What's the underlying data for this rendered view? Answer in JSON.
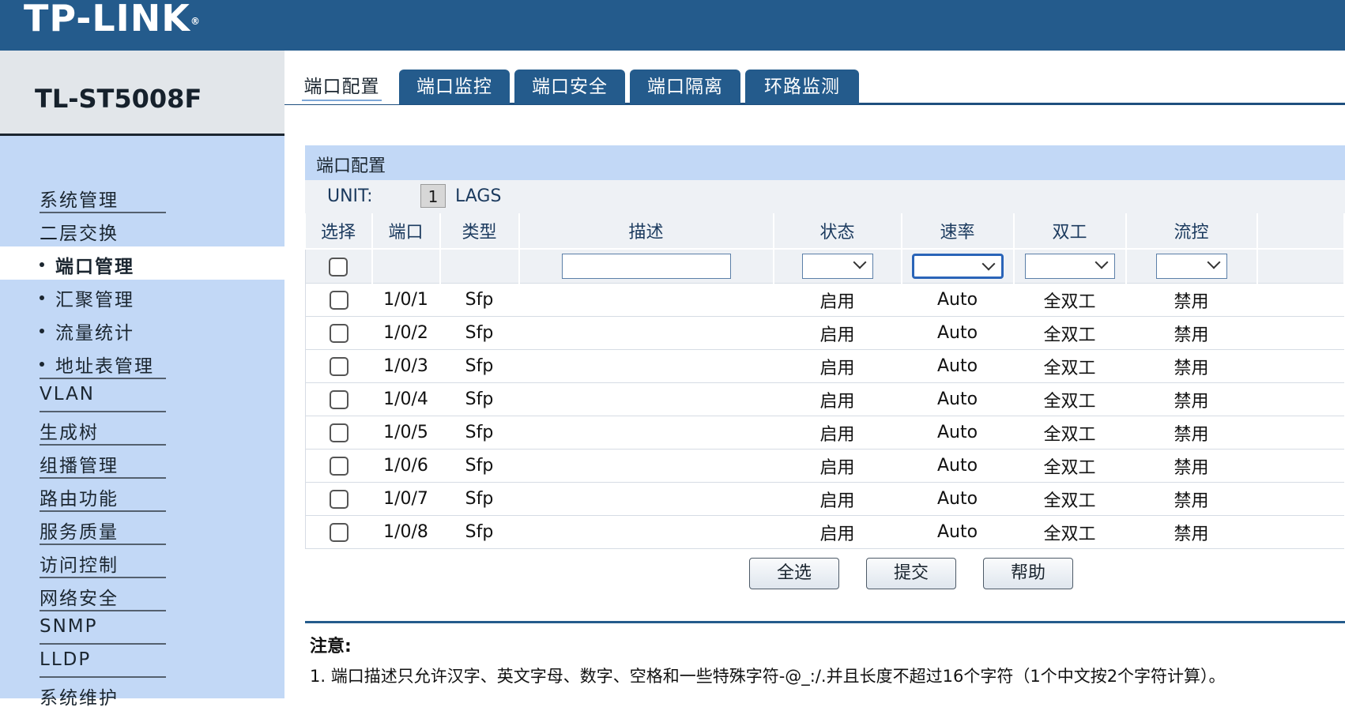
{
  "header": {
    "logo_text": "TP-LINK",
    "logo_mark": "®"
  },
  "device": {
    "model": "TL-ST5008F"
  },
  "sidebar": {
    "items": [
      {
        "label": "系统管理"
      },
      {
        "label": "二层交换"
      },
      {
        "label": "端口管理"
      },
      {
        "label": "汇聚管理"
      },
      {
        "label": "流量统计"
      },
      {
        "label": "地址表管理"
      },
      {
        "label": "VLAN"
      },
      {
        "label": "生成树"
      },
      {
        "label": "组播管理"
      },
      {
        "label": "路由功能"
      },
      {
        "label": "服务质量"
      },
      {
        "label": "访问控制"
      },
      {
        "label": "网络安全"
      },
      {
        "label": "SNMP"
      },
      {
        "label": "LLDP"
      },
      {
        "label": "系统维护"
      }
    ]
  },
  "tabs": [
    {
      "label": "端口配置"
    },
    {
      "label": "端口监控"
    },
    {
      "label": "端口安全"
    },
    {
      "label": "端口隔离"
    },
    {
      "label": "环路监测"
    }
  ],
  "panel": {
    "title": "端口配置",
    "unit_label": "UNIT:",
    "unit_value": "1",
    "lags_label": "LAGS"
  },
  "table": {
    "headers": [
      "选择",
      "端口",
      "类型",
      "描述",
      "状态",
      "速率",
      "双工",
      "流控"
    ],
    "rows": [
      {
        "port": "1/0/1",
        "type": "Sfp",
        "status": "启用",
        "speed": "Auto",
        "duplex": "全双工",
        "flow": "禁用"
      },
      {
        "port": "1/0/2",
        "type": "Sfp",
        "status": "启用",
        "speed": "Auto",
        "duplex": "全双工",
        "flow": "禁用"
      },
      {
        "port": "1/0/3",
        "type": "Sfp",
        "status": "启用",
        "speed": "Auto",
        "duplex": "全双工",
        "flow": "禁用"
      },
      {
        "port": "1/0/4",
        "type": "Sfp",
        "status": "启用",
        "speed": "Auto",
        "duplex": "全双工",
        "flow": "禁用"
      },
      {
        "port": "1/0/5",
        "type": "Sfp",
        "status": "启用",
        "speed": "Auto",
        "duplex": "全双工",
        "flow": "禁用"
      },
      {
        "port": "1/0/6",
        "type": "Sfp",
        "status": "启用",
        "speed": "Auto",
        "duplex": "全双工",
        "flow": "禁用"
      },
      {
        "port": "1/0/7",
        "type": "Sfp",
        "status": "启用",
        "speed": "Auto",
        "duplex": "全双工",
        "flow": "禁用"
      },
      {
        "port": "1/0/8",
        "type": "Sfp",
        "status": "启用",
        "speed": "Auto",
        "duplex": "全双工",
        "flow": "禁用"
      }
    ]
  },
  "buttons": {
    "select_all": "全选",
    "submit": "提交",
    "help": "帮助"
  },
  "note": {
    "title": "注意:",
    "line1": "1. 端口描述只允许汉字、英文字母、数字、空格和一些特殊字符-@_:/.并且长度不超过16个字符（1个中文按2个字符计算）。"
  },
  "colors": {
    "header": "#245b8c",
    "sidebar": "#c2d8f6",
    "panel_title": "#c2d8f6",
    "row_bg": "#eef1f5"
  }
}
